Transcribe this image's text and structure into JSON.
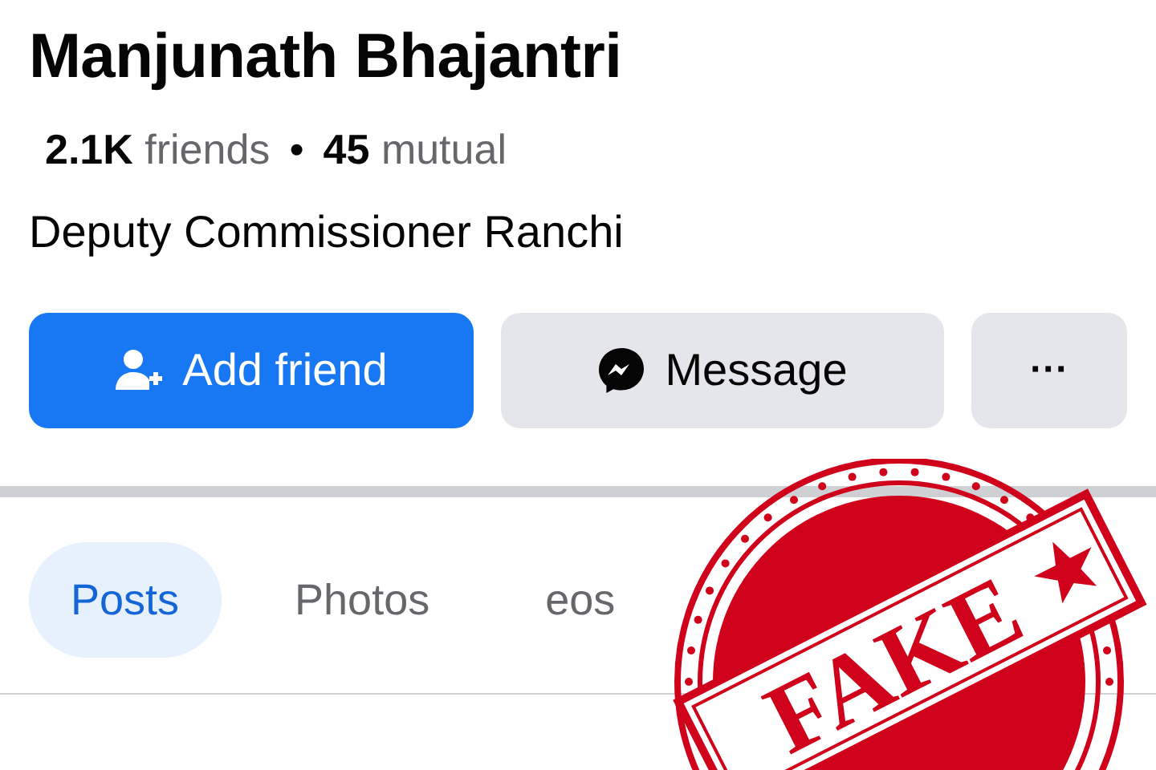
{
  "profile": {
    "name": "Manjunath Bhajantri",
    "stats": [
      "**2.1K** friends",
      "**45** mutual"
    ],
    "stats_separator": "•",
    "bio": "Deputy Commissioner Ranchi"
  },
  "actions": [
    {
      "kind": "primary",
      "label": "Add friend"
    },
    {
      "kind": "secondary",
      "label": "Message"
    },
    {
      "kind": "more",
      "label": "···"
    }
  ],
  "tabs": [
    {
      "label": "Posts",
      "selected": true
    },
    {
      "label": "Photos",
      "selected": false
    },
    {
      "label": "eos",
      "selected": false
    }
  ],
  "stamp": {
    "text": "FAKE"
  }
}
